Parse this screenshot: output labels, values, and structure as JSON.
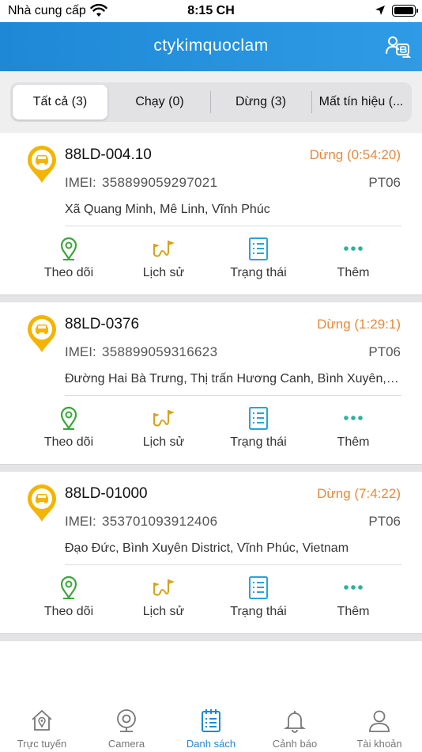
{
  "status_bar": {
    "carrier": "Nhà cung cấp",
    "time": "8:15 CH"
  },
  "header": {
    "title": "ctykimquoclam"
  },
  "tabs": [
    {
      "label": "Tất cả (3)",
      "active": true
    },
    {
      "label": "Chạy (0)",
      "active": false
    },
    {
      "label": "Dừng (3)",
      "active": false
    },
    {
      "label": "Mất tín hiệu (...",
      "active": false
    }
  ],
  "vehicles": [
    {
      "plate": "88LD-004.10",
      "status": "Dừng (0:54:20)",
      "imei_label": "IMEI:",
      "imei": "358899059297021",
      "model": "PT06",
      "address": "Xã Quang Minh, Mê Linh, Vĩnh Phúc"
    },
    {
      "plate": "88LD-0376",
      "status": "Dừng (1:29:1)",
      "imei_label": "IMEI:",
      "imei": "358899059316623",
      "model": "PT06",
      "address": "Đường Hai Bà Trưng, Thị trấn Hương Canh, Bình Xuyên, Vĩnh Phúc"
    },
    {
      "plate": "88LD-01000",
      "status": "Dừng (7:4:22)",
      "imei_label": "IMEI:",
      "imei": "353701093912406",
      "model": "PT06",
      "address": "Đạo Đức, Bình Xuyên District, Vĩnh Phúc, Vietnam"
    }
  ],
  "actions": {
    "track": "Theo dõi",
    "history": "Lịch sử",
    "status": "Trạng thái",
    "more": "Thêm"
  },
  "bottom_nav": [
    {
      "label": "Trực tuyến",
      "icon": "home-location-icon",
      "active": false
    },
    {
      "label": "Camera",
      "icon": "camera-icon",
      "active": false
    },
    {
      "label": "Danh sách",
      "icon": "list-clipboard-icon",
      "active": true
    },
    {
      "label": "Cảnh báo",
      "icon": "bell-icon",
      "active": false
    },
    {
      "label": "Tài khoản",
      "icon": "user-icon",
      "active": false
    }
  ],
  "colors": {
    "header": "#1e88d6",
    "status_text": "#e68a3a",
    "pin_yellow": "#f5b400",
    "track_green": "#3aa63a",
    "history_gold": "#d9a21b",
    "status_blue": "#29a3d9",
    "more_teal": "#2bb39b",
    "nav_active": "#1e88d6"
  }
}
